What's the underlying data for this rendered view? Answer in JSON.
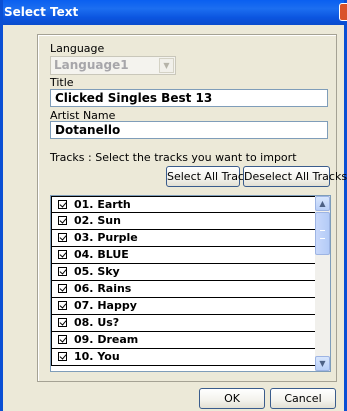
{
  "window": {
    "title": "Select Text"
  },
  "language": {
    "label": "Language",
    "value": "Language1"
  },
  "title_field": {
    "label": "Title",
    "value": "Clicked Singles Best 13"
  },
  "artist_field": {
    "label": "Artist Name",
    "value": "Dotanello"
  },
  "tracks": {
    "instruction": "Tracks   : Select the tracks you want to import",
    "select_all_label": "Select All Tracks",
    "deselect_all_label": "Deselect All Tracks",
    "items": [
      {
        "label": "01. Earth",
        "checked": true
      },
      {
        "label": "02. Sun",
        "checked": true
      },
      {
        "label": "03. Purple",
        "checked": true
      },
      {
        "label": "04. BLUE",
        "checked": true
      },
      {
        "label": "05. Sky",
        "checked": true
      },
      {
        "label": "06. Rains",
        "checked": true
      },
      {
        "label": "07. Happy",
        "checked": true
      },
      {
        "label": "08. Us?",
        "checked": true
      },
      {
        "label": "09. Dream",
        "checked": true
      },
      {
        "label": "10. You",
        "checked": true
      }
    ]
  },
  "footer": {
    "ok_label": "OK",
    "cancel_label": "Cancel"
  }
}
